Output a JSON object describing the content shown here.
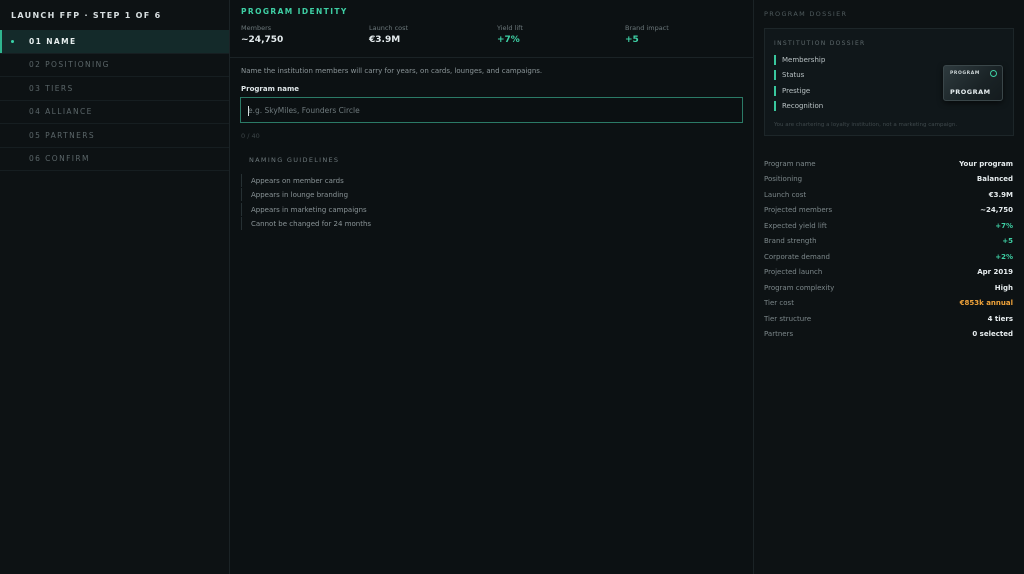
{
  "sidebar": {
    "title": "LAUNCH FFP · STEP 1 OF 6",
    "steps": [
      {
        "label": "01 NAME",
        "active": true
      },
      {
        "label": "02 POSITIONING",
        "active": false
      },
      {
        "label": "03 TIERS",
        "active": false
      },
      {
        "label": "04 ALLIANCE",
        "active": false
      },
      {
        "label": "05 PARTNERS",
        "active": false
      },
      {
        "label": "06 CONFIRM",
        "active": false
      }
    ]
  },
  "main": {
    "section_title": "PROGRAM IDENTITY",
    "stats": [
      {
        "label": "Members",
        "value": "~24,750"
      },
      {
        "label": "Launch cost",
        "value": "€3.9M"
      },
      {
        "label": "Yield lift",
        "value": "+7%"
      },
      {
        "label": "Brand impact",
        "value": "+5"
      }
    ],
    "intro": "Name the institution members will carry for years, on cards, lounges, and campaigns.",
    "field_label": "Program name",
    "input": {
      "value": "",
      "placeholder": "e.g. SkyMiles, Founders Circle"
    },
    "char_count": "0 / 40",
    "guidelines_title": "NAMING GUIDELINES",
    "guidelines": [
      "Appears on member cards",
      "Appears in lounge branding",
      "Appears in marketing campaigns",
      "Cannot be changed for 24 months"
    ]
  },
  "dossier": {
    "title": "PROGRAM DOSSIER",
    "card": {
      "title": "INSTITUTION DOSSIER",
      "features": [
        "Membership",
        "Status",
        "Prestige",
        "Recognition"
      ],
      "badge_small": "PROGRAM",
      "badge_big": "PROGRAM",
      "note": "You are chartering a loyalty institution, not a marketing campaign."
    },
    "summary": [
      {
        "label": "Program name",
        "value": "Your program",
        "tone": "white"
      },
      {
        "label": "Positioning",
        "value": "Balanced",
        "tone": "white"
      },
      {
        "label": "Launch cost",
        "value": "€3.9M",
        "tone": "white"
      },
      {
        "label": "Projected members",
        "value": "~24,750",
        "tone": "white"
      },
      {
        "label": "Expected yield lift",
        "value": "+7%",
        "tone": "green"
      },
      {
        "label": "Brand strength",
        "value": "+5",
        "tone": "green"
      },
      {
        "label": "Corporate demand",
        "value": "+2%",
        "tone": "green"
      },
      {
        "label": "Projected launch",
        "value": "Apr 2019",
        "tone": "white"
      },
      {
        "label": "Program complexity",
        "value": "High",
        "tone": "white"
      },
      {
        "label": "Tier cost",
        "value": "€853k annual",
        "tone": "orange"
      },
      {
        "label": "Tier structure",
        "value": "4 tiers",
        "tone": "white"
      },
      {
        "label": "Partners",
        "value": "0 selected",
        "tone": "white"
      }
    ]
  },
  "colors": {
    "accent": "#3ecfa4",
    "warning": "#f0a33a",
    "background": "#0c1113"
  }
}
